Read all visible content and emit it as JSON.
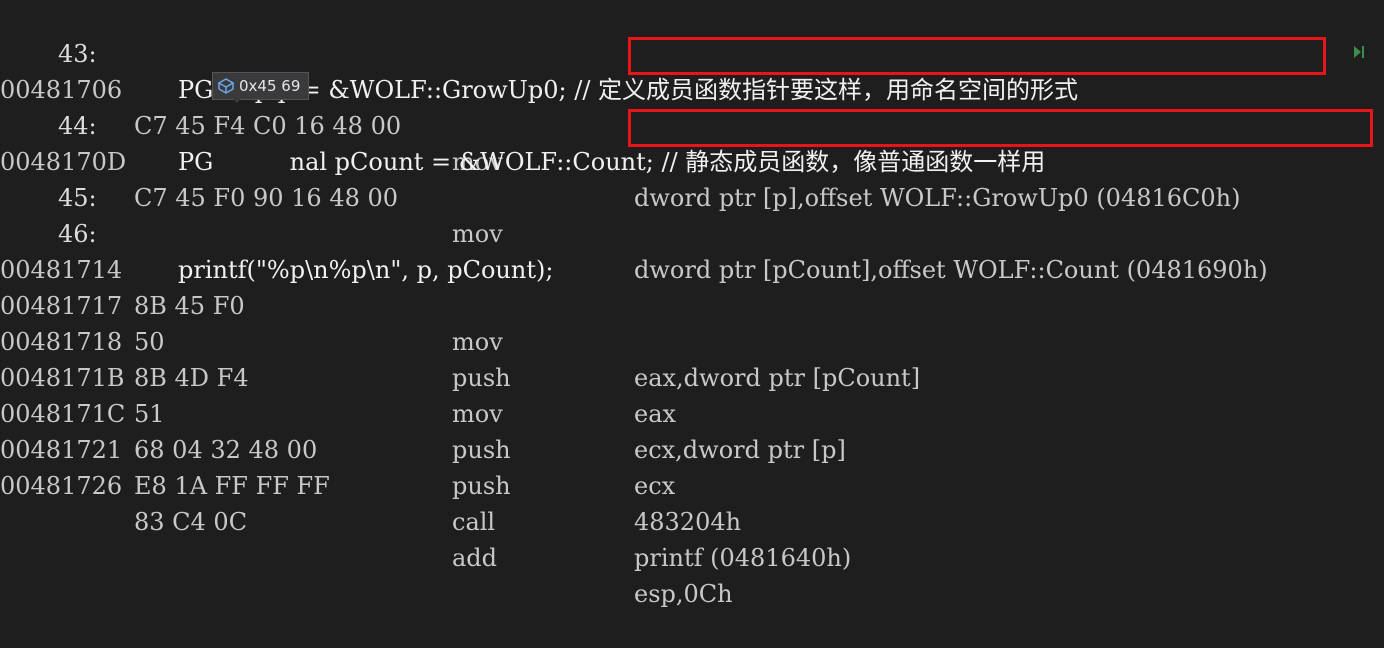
{
  "rows": [
    {
      "kind": "source",
      "lnum": "43:",
      "text": "PGroup p = &WOLF::GrowUp0; // 定义成员函数指针要这样，用命名空间的形式"
    },
    {
      "kind": "asm",
      "addr": "00481706",
      "bytes": "C7 45 F4 C0 16 48 00",
      "mnem": "mov",
      "ops": "dword ptr [p],offset WOLF::GrowUp0 (04816C0h)"
    },
    {
      "kind": "source",
      "lnum": "44:",
      "text": "PG          nal pCount = &WOLF::Count; // 静态成员函数，像普通函数一样用"
    },
    {
      "kind": "asm",
      "addr": "0048170D",
      "bytes": "C7 45 F0 90 16 48 00",
      "mnem": "mov",
      "ops": "dword ptr [pCount],offset WOLF::Count (0481690h)"
    },
    {
      "kind": "source",
      "lnum": "45:",
      "text": ""
    },
    {
      "kind": "source",
      "lnum": "46:",
      "text": "printf(\"%p\\n%p\\n\", p, pCount);"
    },
    {
      "kind": "asm",
      "addr": "00481714",
      "bytes": "8B 45 F0",
      "mnem": "mov",
      "ops": "eax,dword ptr [pCount]"
    },
    {
      "kind": "asm",
      "addr": "00481717",
      "bytes": "50",
      "mnem": "push",
      "ops": "eax"
    },
    {
      "kind": "asm",
      "addr": "00481718",
      "bytes": "8B 4D F4",
      "mnem": "mov",
      "ops": "ecx,dword ptr [p]"
    },
    {
      "kind": "asm",
      "addr": "0048171B",
      "bytes": "51",
      "mnem": "push",
      "ops": "ecx"
    },
    {
      "kind": "asm",
      "addr": "0048171C",
      "bytes": "68 04 32 48 00",
      "mnem": "push",
      "ops": "483204h"
    },
    {
      "kind": "asm",
      "addr": "00481721",
      "bytes": "E8 1A FF FF FF",
      "mnem": "call",
      "ops": "printf (0481640h)"
    },
    {
      "kind": "asm",
      "addr": "00481726",
      "bytes": "83 C4 0C",
      "mnem": "add",
      "ops": "esp,0Ch"
    }
  ],
  "tooltip": {
    "icon": "variable-cube-icon",
    "text": "0x45  69"
  },
  "highlight_color": "#e8141c",
  "run_to_cursor_icon": "run-to-cursor-icon"
}
